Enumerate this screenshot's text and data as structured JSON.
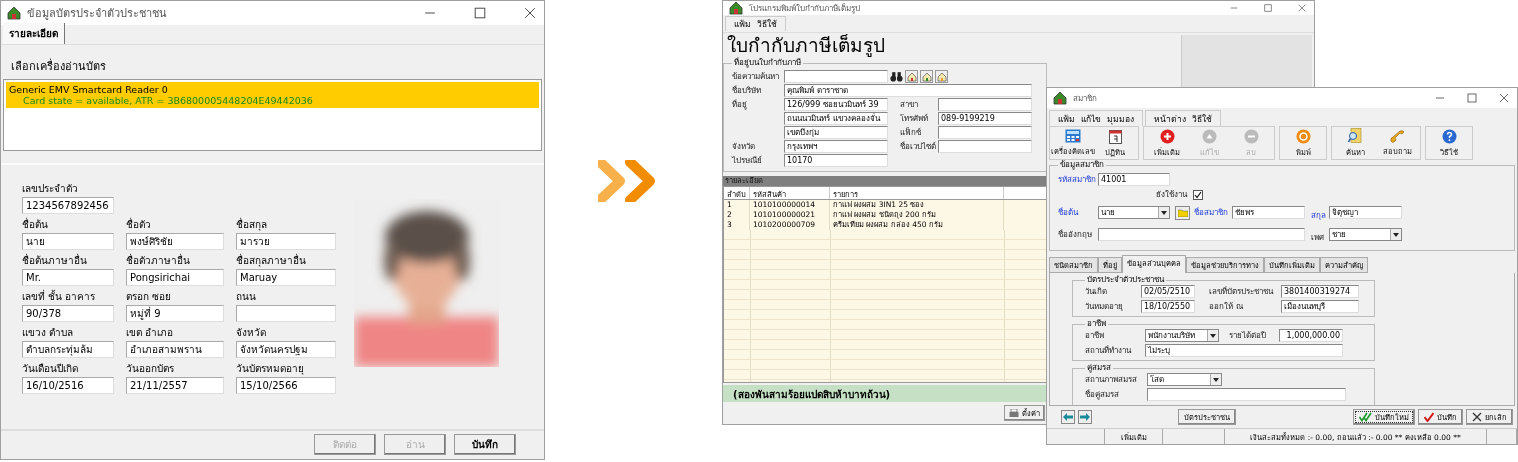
{
  "left_window": {
    "title": "ข้อมูลบัตรประจำตัวประชาชน",
    "tab": {
      "label": "รายละเอียด",
      "selected": true
    },
    "reader_label": "เลือกเครื่องอ่านบัตร",
    "readers": [
      {
        "name": "Generic EMV Smartcard Reader 0",
        "status": "Card state = available, ATR = 3B6800005448204E49442036",
        "selected": true
      }
    ],
    "id_field": {
      "label": "เลขประจำตัว",
      "value": "1234567892456"
    },
    "fields": [
      {
        "label": "ชื่อต้น",
        "value": "นาย"
      },
      {
        "label": "ชื่อตัว",
        "value": "พงษ์ศิริชัย"
      },
      {
        "label": "ชื่อสกุล",
        "value": "มารวย"
      },
      {
        "label": "ชื่อต้นภาษาอื่น",
        "value": "Mr."
      },
      {
        "label": "ชื่อตัวภาษาอื่น",
        "value": "Pongsirichai"
      },
      {
        "label": "ชื่อสกุลภาษาอื่น",
        "value": "Maruay"
      },
      {
        "label": "เลขที่ ชั้น อาคาร",
        "value": "90/378"
      },
      {
        "label": "ตรอก ซอย",
        "value": "หมู่ที่ 9"
      },
      {
        "label": "ถนน"
      },
      {
        "label": "แขวง ตำบล",
        "value": "ตำบลกระทุ่มล้ม"
      },
      {
        "label": "เขต อำเภอ",
        "value": "อำเภอสามพราน"
      },
      {
        "label": "จังหวัด",
        "value": "จังหวัดนครปฐม"
      },
      {
        "label": "วันเดือนปีเกิด",
        "value": "16/10/2516"
      },
      {
        "label": "วันออกบัตร",
        "value": "21/11/2557"
      },
      {
        "label": "วันบัตรหมดอายุ",
        "value": "15/10/2566"
      }
    ],
    "buttons": [
      {
        "label": "ติดต่อ",
        "disabled": true
      },
      {
        "label": "อ่าน",
        "disabled": true
      },
      {
        "label": "บันทึก",
        "disabled": false
      }
    ]
  },
  "invoice_window": {
    "title": "โปรแกรมพิมพ์ใบกำกับภาษีเต็มรูป",
    "menu": [
      "แฟ้ม",
      "วิธีใช้"
    ],
    "heading": "ใบกำกับภาษีเต็มรูป",
    "address_group": {
      "title": "ที่อยู่บนใบกำกับภาษี",
      "search": {
        "label": "ข้อความค้นหา"
      },
      "company": {
        "label": "ชื่อบริษัท",
        "value": "คุณพิมพ์ ดาราชาด"
      },
      "address": {
        "label": "ที่อยู่",
        "lines": [
          "126/999 ซอยนวมินทร์ 39",
          "ถนนนวมินทร์ แขวงคลองจั่น",
          "เขตบึงกุ่ม"
        ]
      },
      "side_fields": [
        {
          "label": "สาขา"
        },
        {
          "label": "โทรศัพท์",
          "value": "089-9199219"
        },
        {
          "label": "แฟ็กซ์"
        },
        {
          "label": "ชื่อเวปไซต์"
        }
      ],
      "province": {
        "label": "จังหวัด",
        "value": "กรุงเทพฯ"
      },
      "postcode": {
        "label": "ไปรษณีย์",
        "value": "10170"
      }
    },
    "details": {
      "title": "รายละเอียด",
      "columns": [
        "ลำดับ",
        "รหัสสินค้า",
        "รายการ"
      ],
      "rows": [
        [
          "1",
          "1010100000014",
          "กาแฟ ผงผสม 3IN1 25 ซอง"
        ],
        [
          "2",
          "1010100000021",
          "กาแฟ ผงผสม ชนิดถุง 200 กรัม"
        ],
        [
          "3",
          "1010200000709",
          "ครีมเทียม ผงผสม กล่อง 450 กรัม"
        ]
      ]
    },
    "amount_text": "(สองพันสามร้อยแปดสิบห้าบาทถ้วน)",
    "buttons": [
      {
        "label": "ตั้งค่า"
      }
    ]
  },
  "member_window": {
    "title": "สมาชิก",
    "menus": [
      [
        "แฟ้ม",
        "แก้ไข",
        "มุมมอง"
      ],
      [
        "หน้าต่าง",
        "วิธีใช้"
      ]
    ],
    "toolbar": [
      {
        "buttons": [
          {
            "label": "เครื่องคิดเลข",
            "kind": "calculator",
            "disabled": false
          },
          {
            "label": "ปฏิทิน",
            "kind": "calendar",
            "disabled": false
          }
        ]
      },
      {
        "buttons": [
          {
            "label": "เพิ่มเติม",
            "kind": "add",
            "disabled": false
          },
          {
            "label": "แก้ไข",
            "kind": "edit",
            "disabled": true
          },
          {
            "label": "ลบ",
            "kind": "delete",
            "disabled": true
          }
        ]
      },
      {
        "buttons": [
          {
            "label": "พิมพ์",
            "kind": "print",
            "disabled": false
          }
        ]
      },
      {
        "buttons": [
          {
            "label": "ค้นหา",
            "kind": "search",
            "disabled": false
          },
          {
            "label": "สอบถาม",
            "kind": "query",
            "disabled": false
          }
        ]
      },
      {
        "buttons": [
          {
            "label": "วิธีใช้",
            "kind": "help",
            "disabled": false
          }
        ]
      }
    ],
    "member_group": {
      "title": "ข้อมูลสมาชิก",
      "member_id": {
        "label": "รหัสสมาชิก",
        "value": "41001",
        "required": true
      },
      "active": {
        "label": "ยังใช้งาน",
        "checked": true
      },
      "prefix": {
        "label": "ชื่อต้น",
        "value": "นาย",
        "required": true
      },
      "name": {
        "label": "ชื่อสมาชิก",
        "value": "ชัยพร",
        "required": true
      },
      "surname": {
        "label": "สกุล",
        "value": "จิตุชญา",
        "required": true
      },
      "english_name": {
        "label": "ชื่ออังกฤษ",
        "required": false
      },
      "gender": {
        "label": "เพศ",
        "value": "ชาย",
        "required": false
      }
    },
    "tabs": [
      {
        "label": "ชนิดสมาชิก",
        "selected": false
      },
      {
        "label": "ที่อยู่",
        "selected": false
      },
      {
        "label": "ข้อมูลส่วนบุคคล",
        "selected": true
      },
      {
        "label": "ข้อมูลช่วยบริการทาง",
        "selected": false
      },
      {
        "label": "บันทึกเพิ่มเติม",
        "selected": false
      },
      {
        "label": "ความสำคัญ",
        "selected": false
      }
    ],
    "id_card": {
      "title": "บัตรประจำตัวประชาชน",
      "birth": {
        "label": "วันเกิด",
        "value": "02/05/2510"
      },
      "card_no": {
        "label": "เลขที่บัตรประชาชน",
        "value": "3801400319274"
      },
      "expiry": {
        "label": "วันหมดอายุ",
        "value": "18/10/2550"
      },
      "issued_at": {
        "label": "ออกให้ ณ",
        "value": "เมืองนนทบุรี"
      }
    },
    "occupation": {
      "title": "อาชีพ",
      "job": {
        "label": "อาชีพ",
        "value": "พนักงานบริษัท"
      },
      "income": {
        "label": "รายได้ต่อปี",
        "value": "1,000,000.00"
      },
      "workplace": {
        "label": "สถานที่ทำงาน",
        "value": "ไม่ระบุ"
      }
    },
    "spouse": {
      "title": "คู่สมรส",
      "status": {
        "label": "สถานภาพสมรส",
        "value": "โสด"
      },
      "name": {
        "label": "ชื่อคู่สมรส"
      }
    },
    "card_button": "บัตรประชาชน",
    "buttons": [
      {
        "label": "บันทึกใหม่",
        "kind": "save_new"
      },
      {
        "label": "บันทึก",
        "kind": "save"
      },
      {
        "label": "ยกเลิก",
        "kind": "cancel"
      }
    ],
    "status_bar": [
      "เพิ่มเติม",
      "เงินสะสมทั้งหมด :-  0.00, ถอนแล้ว :-  0.00 ** คงเหลือ  0.00 **"
    ]
  }
}
